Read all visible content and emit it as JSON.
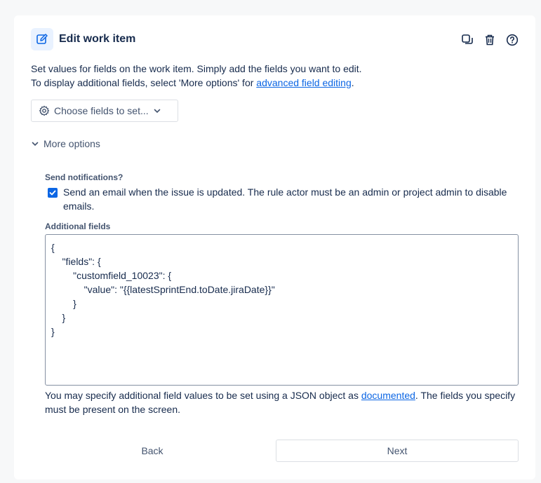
{
  "header": {
    "title": "Edit work item"
  },
  "description": {
    "line1": "Set values for fields on the work item. Simply add the fields you want to edit.",
    "line2_prefix": "To display additional fields, select 'More options' for ",
    "line2_link": "advanced field editing",
    "line2_suffix": "."
  },
  "choose_fields": {
    "label": "Choose fields to set..."
  },
  "more_options": {
    "label": "More options"
  },
  "notifications": {
    "label": "Send notifications?",
    "checkbox_text": "Send an email when the issue is updated. The rule actor must be an admin or project admin to disable emails.",
    "checked": true
  },
  "additional_fields": {
    "label": "Additional fields",
    "value": "{\n    \"fields\": {\n        \"customfield_10023\": {\n            \"value\": \"{{latestSprintEnd.toDate.jiraDate}}\"\n        }\n    }\n}"
  },
  "help": {
    "prefix": "You may specify additional field values to be set using a JSON object as ",
    "link": "documented",
    "suffix": ". The fields you specify must be present on the screen."
  },
  "footer": {
    "back_label": "Back",
    "next_label": "Next"
  },
  "colors": {
    "accent": "#0c66e4",
    "icon_bg": "#e9f2ff"
  }
}
